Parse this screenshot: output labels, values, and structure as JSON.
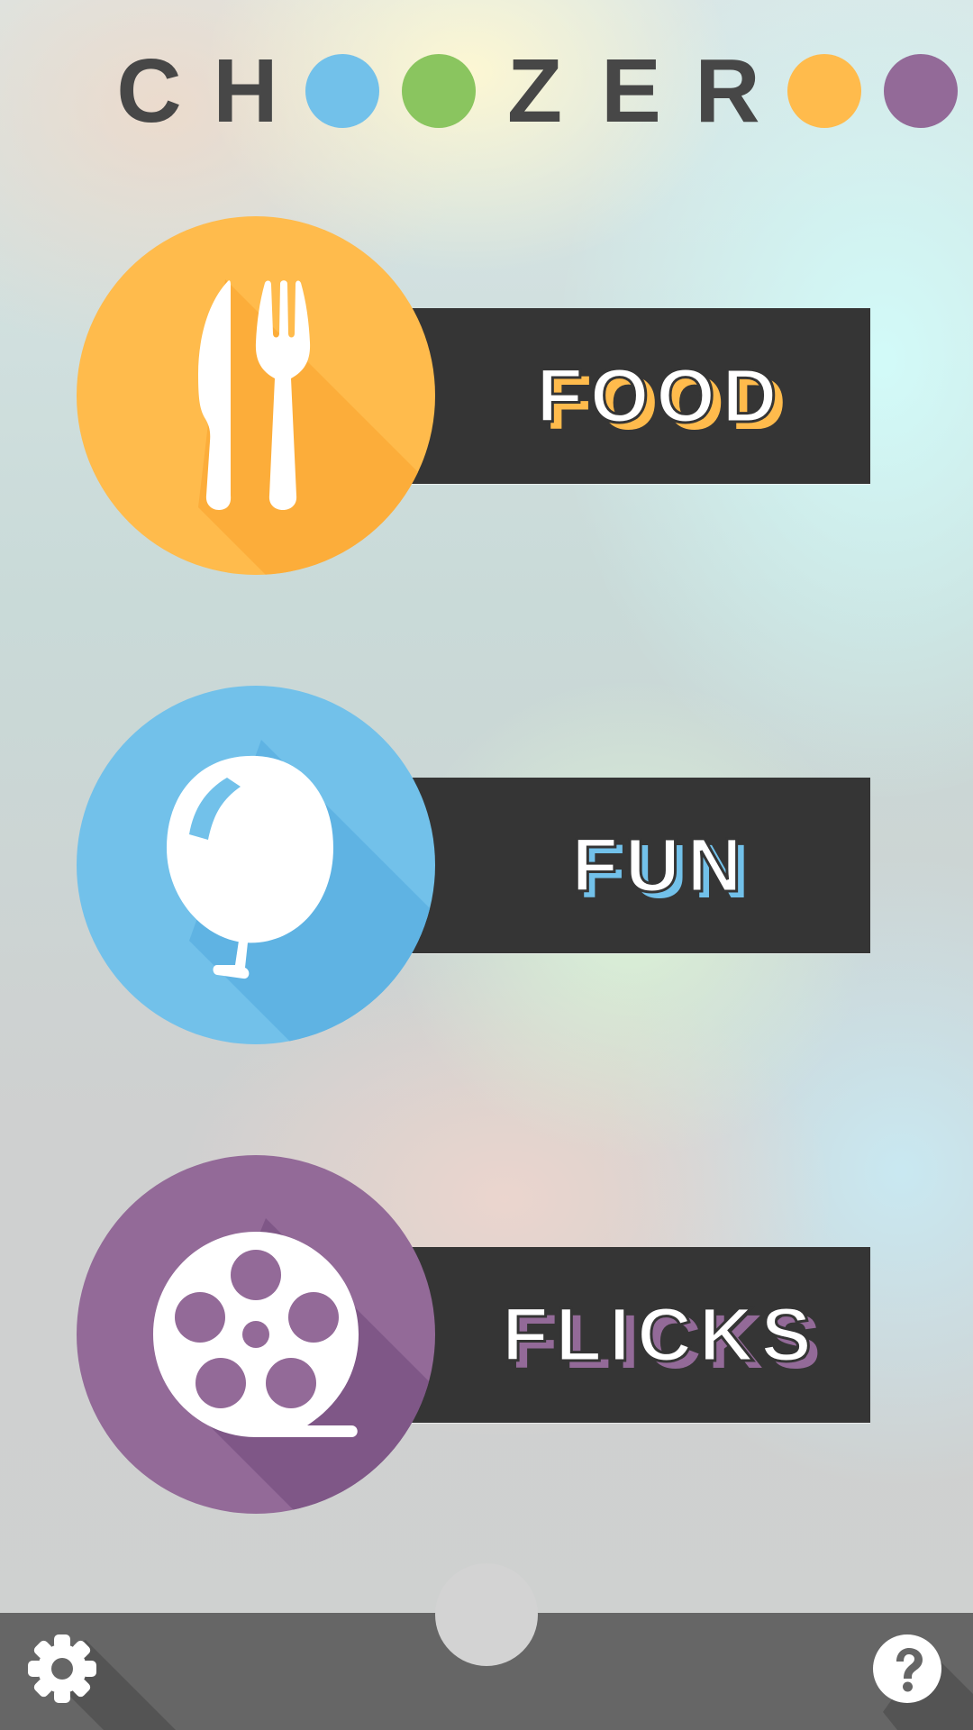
{
  "logo": {
    "letters": [
      "C",
      "H",
      "Z",
      "E",
      "R"
    ],
    "dot_colors": [
      "#72c1ea",
      "#8ac55f",
      "#ffbb4c",
      "#936a98"
    ]
  },
  "categories": [
    {
      "label": "FOOD",
      "icon": "fork-knife-icon",
      "color": "#ffbb4c",
      "shade": "#fcad3a",
      "shadow_text": "#ffbb4c"
    },
    {
      "label": "FUN",
      "icon": "balloon-icon",
      "color": "#72c1ea",
      "shade": "#5fb3e3",
      "shadow_text": "#72c1ea"
    },
    {
      "label": "FLICKS",
      "icon": "film-reel-icon",
      "color": "#936a98",
      "shade": "#7f5787",
      "shadow_text": "#936a98"
    }
  ],
  "bottom_bar": {
    "settings_icon": "gear-icon",
    "help_icon": "help-icon",
    "color": "#666666"
  }
}
